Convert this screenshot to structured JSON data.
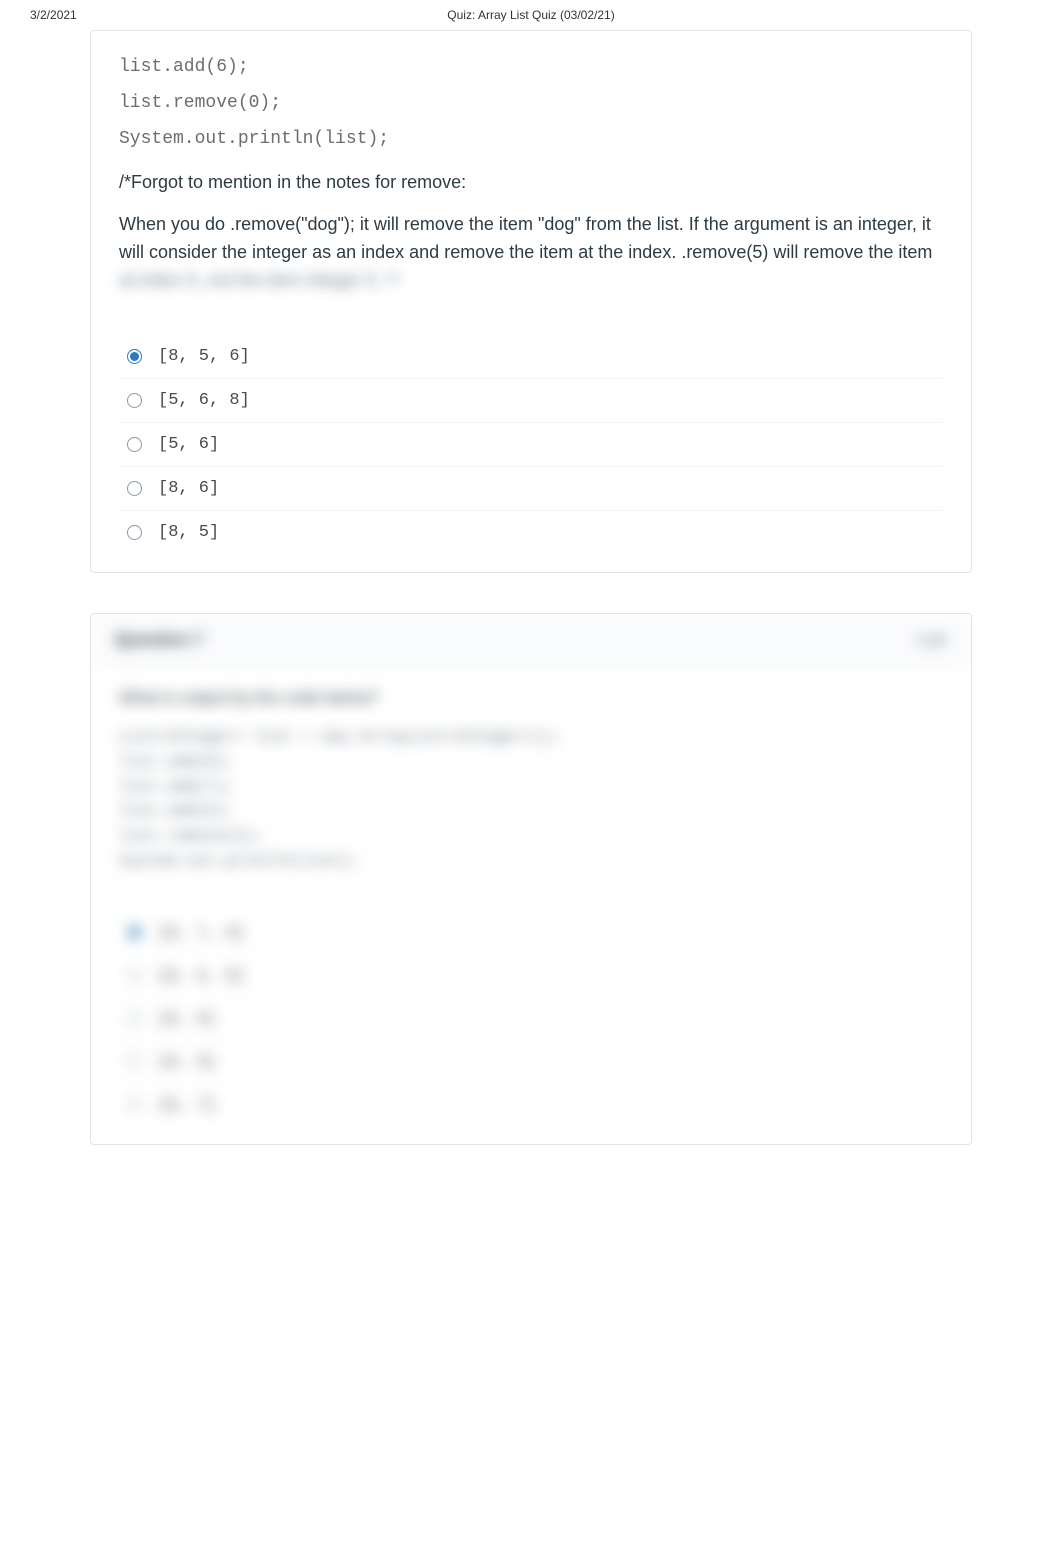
{
  "header": {
    "date": "3/2/2021",
    "title": "Quiz: Array List Quiz (03/02/21)"
  },
  "question1": {
    "code": "list.add(6);\nlist.remove(0);\nSystem.out.println(list);",
    "note1": "/*Forgot to mention in the notes for remove:",
    "note2a": "When you do .remove(\"dog\"); it will remove the item \"dog\" from the list. If the argument is an integer, it will consider the integer as an index and remove the item at the index. .remove(5) will remove the item ",
    "note2b": "at index 5, not the item integer 5.           */",
    "answers": [
      {
        "text": "[8, 5, 6]",
        "selected": true
      },
      {
        "text": "[5, 6, 8]",
        "selected": false
      },
      {
        "text": "[5, 6]",
        "selected": false
      },
      {
        "text": "[8, 6]",
        "selected": false
      },
      {
        "text": "[8, 5]",
        "selected": false
      }
    ]
  },
  "question2": {
    "title": "Question 7",
    "points": "1 pts",
    "prompt": "What is output by the code below?",
    "code": "List<Integer> list = new ArrayList<Integer>();\nlist.add(8);\nlist.add(7);\nlist.add(6);\nlist.remove(2);\nSystem.out.println(list);",
    "answers": [
      {
        "text": "[8, 7, 6]",
        "selected": true
      },
      {
        "text": "[8, 6, 8]",
        "selected": false
      },
      {
        "text": "[8, 6]",
        "selected": false
      },
      {
        "text": "[8, 6]",
        "selected": false
      },
      {
        "text": "[8, 7]",
        "selected": false
      }
    ]
  }
}
